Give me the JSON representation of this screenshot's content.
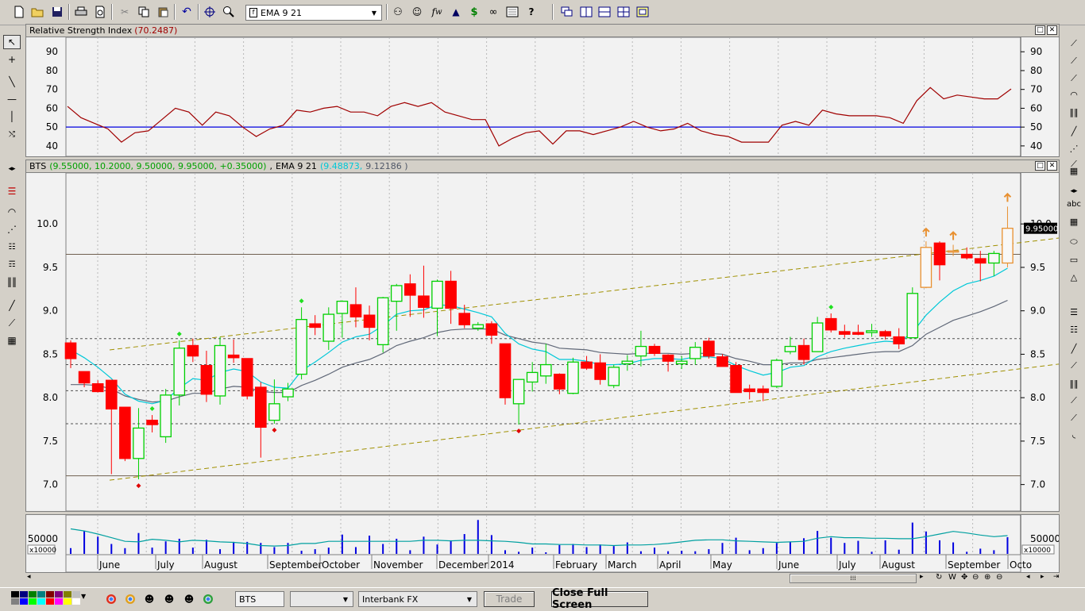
{
  "toolbar": {
    "indicator_combo": "EMA 9 21",
    "icons": [
      "new-file-icon",
      "open-folder-icon",
      "save-icon",
      "print-icon",
      "print-preview-icon",
      "cut-icon",
      "copy-icon",
      "paste-icon",
      "undo-icon",
      "crosshair-icon",
      "zoom-icon",
      "indicator-icon",
      "function-icon",
      "alert-icon",
      "dollar-icon",
      "binoculars-icon",
      "properties-icon",
      "help-icon",
      "cascade-icon",
      "tile-vertical-icon",
      "tile-horizontal-icon",
      "tile-grid-icon",
      "layout-icon"
    ]
  },
  "rsi_panel": {
    "title": "Relative Strength Index",
    "value": "(70.2487)",
    "y_ticks": [
      "90",
      "80",
      "70",
      "60",
      "50",
      "40"
    ]
  },
  "price_panel": {
    "symbol": "BTS",
    "ohlc": "(9.55000, 10.2000, 9.50000, 9.95000, +0.35000)",
    "ema_label": "EMA 9 21",
    "ema_fast": "(9.48873,",
    "ema_slow": "9.12186 )",
    "last_price": "9.95000",
    "y_ticks": [
      "10.0",
      "9.5",
      "9.0",
      "8.5",
      "8.0",
      "7.5",
      "7.0"
    ]
  },
  "volume_panel": {
    "tick": "50000",
    "multiplier": "x10000"
  },
  "x_axis": {
    "labels": [
      "June",
      "July",
      "August",
      "September",
      "October",
      "November",
      "December",
      "2014",
      "February",
      "March",
      "April",
      "May",
      "June",
      "July",
      "August",
      "September",
      "Octo"
    ]
  },
  "bottom": {
    "symbol_field": "BTS",
    "interval_field": "",
    "feed_field": "Interbank FX",
    "trade_button": "Trade",
    "close_fullscreen_button": "Close Full Screen"
  },
  "colors": {
    "up_candle": "#00d000",
    "down_candle": "#ff0000",
    "rsi_line": "#a00000",
    "ema_fast": "#00c8d8",
    "ema_slow": "#606878",
    "volume": "#0000e0",
    "channel": "#a09000"
  },
  "chart_data": {
    "type": "candlestick",
    "candles": [
      [
        8.63,
        8.66,
        8.34,
        8.45
      ],
      [
        8.3,
        8.3,
        8.12,
        8.17
      ],
      [
        8.16,
        8.2,
        8.06,
        8.07
      ],
      [
        8.2,
        8.2,
        7.12,
        7.87
      ],
      [
        7.89,
        7.89,
        7.27,
        7.3
      ],
      [
        7.3,
        7.88,
        7.06,
        7.65
      ],
      [
        7.74,
        7.8,
        7.6,
        7.69
      ],
      [
        7.55,
        8.1,
        7.48,
        8.03
      ],
      [
        8.03,
        8.66,
        7.91,
        8.57
      ],
      [
        8.6,
        8.68,
        8.41,
        8.48
      ],
      [
        8.37,
        8.54,
        7.95,
        8.04
      ],
      [
        8.02,
        8.7,
        7.92,
        8.6
      ],
      [
        8.49,
        8.67,
        8.4,
        8.46
      ],
      [
        8.45,
        8.45,
        7.98,
        8.02
      ],
      [
        8.12,
        8.18,
        7.31,
        7.66
      ],
      [
        7.74,
        8.21,
        7.7,
        7.93
      ],
      [
        8.01,
        8.17,
        7.96,
        8.1
      ],
      [
        8.27,
        9.04,
        8.21,
        8.9
      ],
      [
        8.85,
        8.95,
        8.72,
        8.81
      ],
      [
        8.65,
        9.04,
        8.55,
        8.96
      ],
      [
        8.97,
        9.12,
        8.69,
        9.11
      ],
      [
        9.07,
        9.27,
        8.81,
        8.93
      ],
      [
        8.95,
        9.06,
        8.66,
        8.81
      ],
      [
        8.61,
        9.16,
        8.52,
        9.15
      ],
      [
        9.11,
        9.31,
        8.77,
        9.29
      ],
      [
        9.31,
        9.42,
        8.93,
        9.18
      ],
      [
        9.17,
        9.52,
        8.92,
        9.04
      ],
      [
        9.03,
        9.36,
        8.71,
        9.34
      ],
      [
        9.34,
        9.46,
        8.85,
        9.03
      ],
      [
        8.97,
        9.07,
        8.8,
        8.84
      ],
      [
        8.8,
        8.87,
        8.77,
        8.84
      ],
      [
        8.85,
        8.88,
        8.62,
        8.72
      ],
      [
        8.62,
        8.62,
        7.92,
        8.0
      ],
      [
        7.93,
        8.2,
        7.69,
        8.21
      ],
      [
        8.18,
        8.41,
        8.07,
        8.29
      ],
      [
        8.25,
        8.62,
        8.16,
        8.38
      ],
      [
        8.27,
        8.28,
        8.04,
        8.1
      ],
      [
        8.05,
        8.46,
        8.04,
        8.41
      ],
      [
        8.41,
        8.48,
        8.32,
        8.34
      ],
      [
        8.4,
        8.5,
        8.15,
        8.21
      ],
      [
        8.14,
        8.38,
        8.11,
        8.35
      ],
      [
        8.39,
        8.49,
        8.31,
        8.42
      ],
      [
        8.48,
        8.77,
        8.36,
        8.59
      ],
      [
        8.59,
        8.62,
        8.48,
        8.51
      ],
      [
        8.49,
        8.5,
        8.3,
        8.42
      ],
      [
        8.39,
        8.48,
        8.33,
        8.42
      ],
      [
        8.45,
        8.64,
        8.38,
        8.58
      ],
      [
        8.65,
        8.69,
        8.45,
        8.48
      ],
      [
        8.47,
        8.5,
        8.36,
        8.36
      ],
      [
        8.37,
        8.41,
        8.06,
        8.06
      ],
      [
        8.1,
        8.15,
        7.98,
        8.07
      ],
      [
        8.1,
        8.14,
        7.96,
        8.06
      ],
      [
        8.13,
        8.45,
        8.11,
        8.43
      ],
      [
        8.53,
        8.7,
        8.5,
        8.59
      ],
      [
        8.6,
        8.68,
        8.38,
        8.44
      ],
      [
        8.53,
        8.93,
        8.53,
        8.86
      ],
      [
        8.91,
        8.97,
        8.75,
        8.78
      ],
      [
        8.76,
        8.84,
        8.69,
        8.73
      ],
      [
        8.75,
        8.84,
        8.72,
        8.73
      ],
      [
        8.75,
        8.85,
        8.7,
        8.77
      ],
      [
        8.76,
        8.78,
        8.67,
        8.71
      ],
      [
        8.7,
        8.8,
        8.56,
        8.62
      ],
      [
        8.69,
        9.27,
        8.69,
        9.2
      ],
      [
        9.27,
        9.8,
        9.26,
        9.73
      ],
      [
        9.78,
        9.8,
        9.35,
        9.53
      ],
      [
        9.69,
        9.76,
        9.63,
        9.69
      ],
      [
        9.65,
        9.73,
        9.59,
        9.61
      ],
      [
        9.6,
        9.69,
        9.34,
        9.55
      ],
      [
        9.55,
        9.69,
        9.4,
        9.66
      ],
      [
        9.55,
        10.2,
        9.5,
        9.95
      ]
    ],
    "ema_fast": [
      8.55,
      8.46,
      8.35,
      8.22,
      8.04,
      7.96,
      7.93,
      7.97,
      8.11,
      8.22,
      8.2,
      8.29,
      8.33,
      8.3,
      8.18,
      8.12,
      8.11,
      8.31,
      8.41,
      8.52,
      8.64,
      8.7,
      8.73,
      8.83,
      8.96,
      9.0,
      9.01,
      9.07,
      9.06,
      9.02,
      8.98,
      8.93,
      8.74,
      8.62,
      8.56,
      8.53,
      8.44,
      8.44,
      8.42,
      8.38,
      8.38,
      8.39,
      8.43,
      8.45,
      8.45,
      8.44,
      8.47,
      8.47,
      8.45,
      8.37,
      8.31,
      8.26,
      8.29,
      8.35,
      8.37,
      8.47,
      8.53,
      8.57,
      8.6,
      8.63,
      8.65,
      8.64,
      8.75,
      8.95,
      9.1,
      9.23,
      9.31,
      9.35,
      9.4,
      9.49
    ],
    "ema_slow": [
      8.15,
      8.15,
      8.14,
      8.1,
      8.02,
      7.98,
      7.95,
      7.96,
      8.01,
      8.05,
      8.05,
      8.1,
      8.13,
      8.12,
      8.07,
      8.06,
      8.06,
      8.14,
      8.2,
      8.27,
      8.35,
      8.4,
      8.44,
      8.51,
      8.6,
      8.65,
      8.69,
      8.75,
      8.78,
      8.79,
      8.79,
      8.79,
      8.72,
      8.68,
      8.64,
      8.62,
      8.57,
      8.56,
      8.55,
      8.52,
      8.51,
      8.5,
      8.51,
      8.51,
      8.51,
      8.5,
      8.51,
      8.51,
      8.5,
      8.45,
      8.42,
      8.38,
      8.38,
      8.4,
      8.4,
      8.44,
      8.46,
      8.48,
      8.5,
      8.52,
      8.53,
      8.53,
      8.6,
      8.73,
      8.81,
      8.89,
      8.94,
      8.99,
      9.05,
      9.12
    ],
    "rsi": [
      61,
      55,
      52,
      49,
      42,
      47,
      48,
      54,
      60,
      58,
      51,
      58,
      56,
      50,
      45,
      49,
      51,
      59,
      58,
      60,
      61,
      58,
      58,
      56,
      61,
      63,
      61,
      63,
      58,
      56,
      54,
      54,
      40,
      44,
      47,
      48,
      41,
      48,
      48,
      46,
      48,
      50,
      53,
      50,
      48,
      49,
      52,
      48,
      46,
      45,
      42,
      42,
      42,
      51,
      53,
      51,
      59,
      57,
      56,
      56,
      56,
      55,
      52,
      64,
      71,
      65,
      67,
      66,
      65,
      65,
      70.25
    ],
    "rsi_ylim": [
      37,
      96
    ],
    "volume": [
      1.1,
      4.4,
      3.3,
      1.9,
      1.1,
      4.0,
      1.2,
      2.4,
      2.9,
      1.2,
      2.7,
      0.9,
      2.3,
      2.3,
      2.1,
      1.3,
      2.1,
      0.6,
      0.9,
      1.2,
      3.7,
      1.3,
      3.5,
      1.9,
      2.9,
      0.7,
      3.3,
      1.8,
      2.6,
      3.8,
      6.5,
      3.6,
      0.7,
      0.4,
      1.2,
      0.3,
      1.7,
      1.9,
      1.3,
      1.8,
      1.5,
      2.2,
      0.5,
      1.2,
      0.5,
      0.6,
      0.5,
      0.9,
      2.1,
      3.1,
      0.7,
      1.1,
      2.1,
      2.3,
      3.0,
      4.4,
      3.1,
      2.1,
      2.5,
      0.4,
      2.6,
      0.8,
      6.0,
      4.3,
      2.6,
      2.2,
      0.4,
      1.0,
      0.7,
      3.2
    ],
    "volume_ema": [
      4.8,
      4.4,
      3.8,
      3.1,
      2.4,
      2.3,
      2.8,
      2.6,
      2.3,
      2.6,
      2.5,
      2.3,
      2.2,
      2.0,
      1.6,
      1.5,
      1.6,
      2.0,
      2.0,
      2.4,
      2.4,
      2.4,
      2.4,
      2.4,
      2.4,
      2.4,
      2.6,
      2.6,
      2.5,
      2.6,
      2.6,
      2.5,
      2.4,
      2.2,
      1.9,
      1.9,
      1.8,
      1.8,
      1.7,
      1.7,
      1.6,
      1.7,
      1.7,
      1.8,
      2.0,
      2.3,
      2.6,
      2.7,
      2.7,
      2.5,
      2.4,
      2.3,
      2.2,
      2.3,
      2.4,
      3.0,
      3.3,
      3.1,
      3.1,
      3.0,
      3.0,
      2.9,
      2.9,
      3.3,
      3.8,
      4.3,
      4.0,
      3.6,
      3.3,
      3.5
    ],
    "price_ylim": [
      6.75,
      10.55
    ],
    "horizontal_levels": [
      9.65,
      8.68,
      8.38,
      8.08,
      7.7,
      7.1
    ],
    "channel_upper": [
      [
        8.55,
        9.8
      ],
      [
        1.0,
        9.85
      ]
    ],
    "channel_lower": [
      [
        7.05,
        7.95
      ],
      [
        1.0,
        8.4
      ]
    ],
    "up_arrows": [
      63,
      65,
      69
    ],
    "signal_up_green": [
      6,
      8,
      17,
      56
    ],
    "signal_down_red": [
      5,
      15,
      33
    ]
  }
}
